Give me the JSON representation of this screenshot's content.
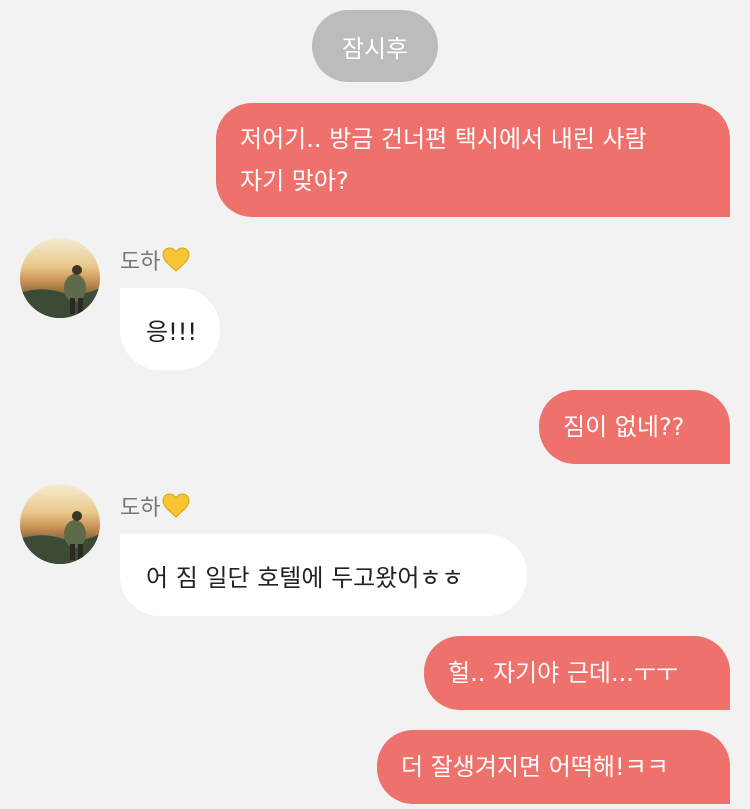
{
  "system_notice": "잠시후",
  "colors": {
    "background": "#f2f2f2",
    "outgoing_bubble": "#ef716c",
    "incoming_bubble": "#ffffff",
    "system_pill": "#bcbcbc",
    "sender_name": "#777777",
    "heart": "#f7c531"
  },
  "messages": [
    {
      "direction": "outgoing",
      "lines": [
        "저어기.. 방금 건너편 택시에서 내린 사람",
        "자기 맞아?"
      ]
    },
    {
      "direction": "incoming",
      "sender": "도하",
      "sender_icon": "yellow-heart-icon",
      "text": "응!!!"
    },
    {
      "direction": "outgoing",
      "text": "짐이 없네??"
    },
    {
      "direction": "incoming",
      "sender": "도하",
      "sender_icon": "yellow-heart-icon",
      "text": "어 짐 일단 호텔에 두고왔어ㅎㅎ"
    },
    {
      "direction": "outgoing",
      "text": "헐.. 자기야 근데...ㅜㅜ"
    },
    {
      "direction": "outgoing",
      "text": "더 잘생겨지면 어떡해!ㅋㅋ"
    }
  ]
}
